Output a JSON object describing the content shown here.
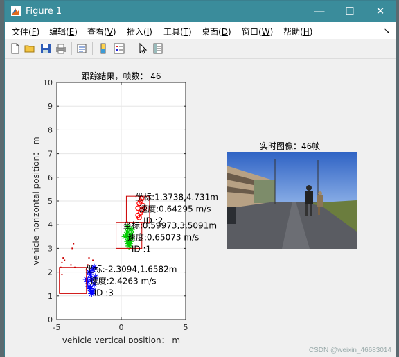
{
  "window": {
    "title": "Figure 1",
    "min": "—",
    "max": "☐",
    "close": "✕"
  },
  "menu": [
    {
      "label": "文件(",
      "key": "F",
      "end": ")"
    },
    {
      "label": "编辑(",
      "key": "E",
      "end": ")"
    },
    {
      "label": "查看(",
      "key": "V",
      "end": ")"
    },
    {
      "label": "插入(",
      "key": "I",
      "end": ")"
    },
    {
      "label": "工具(",
      "key": "T",
      "end": ")"
    },
    {
      "label": "桌面(",
      "key": "D",
      "end": ")"
    },
    {
      "label": "窗口(",
      "key": "W",
      "end": ")"
    },
    {
      "label": "帮助(",
      "key": "H",
      "end": ")"
    }
  ],
  "toolbar": [
    "new-figure-icon",
    "open-file-icon",
    "save-icon",
    "print-icon",
    "link-icon",
    "colorbar-icon",
    "legend-icon",
    "pointer-icon",
    "property-editor-icon"
  ],
  "chart_data": {
    "type": "scatter",
    "title": "跟踪结果，帧数：  46",
    "xlabel": "vehicle vertical position：  m",
    "ylabel": "vehicle horizontal position：  m",
    "xlim": [
      -5,
      5
    ],
    "ylim": [
      0,
      10
    ],
    "xticks": [
      -5,
      0,
      5
    ],
    "yticks": [
      0,
      1,
      2,
      3,
      4,
      5,
      6,
      7,
      8,
      9,
      10
    ],
    "grid": true,
    "objects": [
      {
        "id": "ID :2",
        "color": "#ff0000",
        "marker": "o",
        "box": [
          0.4,
          4.1,
          2.2,
          5.2
        ],
        "coord": "坐标:1.3738,4.731m",
        "speed": "速度:0.64295  m/s",
        "points": [
          [
            1.3,
            4.7
          ],
          [
            1.5,
            5.0
          ],
          [
            1.6,
            4.6
          ],
          [
            1.4,
            4.9
          ],
          [
            1.7,
            4.8
          ],
          [
            1.5,
            4.5
          ],
          [
            1.6,
            5.1
          ],
          [
            1.3,
            4.4
          ],
          [
            1.8,
            4.7
          ],
          [
            1.4,
            4.3
          ]
        ]
      },
      {
        "id": "ID :1",
        "color": "#00cc00",
        "marker": "*",
        "box": [
          -0.4,
          3.0,
          1.6,
          4.1
        ],
        "coord": "坐标:0.59973,3.5091m",
        "speed": "速度:0.65073  m/s",
        "points": [
          [
            0.6,
            3.5
          ],
          [
            0.5,
            3.7
          ],
          [
            0.7,
            3.3
          ],
          [
            0.4,
            3.6
          ],
          [
            0.8,
            3.8
          ],
          [
            0.6,
            3.2
          ],
          [
            0.5,
            3.9
          ],
          [
            0.7,
            3.4
          ],
          [
            0.3,
            3.5
          ],
          [
            0.8,
            3.6
          ],
          [
            0.6,
            3.1
          ],
          [
            0.5,
            3.3
          ]
        ]
      },
      {
        "id": "ID :3",
        "color": "#0000ff",
        "marker": "*",
        "box": [
          -4.8,
          1.1,
          -2.7,
          2.2
        ],
        "coord": "坐标:-2.3094,1.6582m",
        "speed": "速度:2.4263  m/s",
        "points": [
          [
            -2.3,
            1.7
          ],
          [
            -2.5,
            2.0
          ],
          [
            -2.1,
            1.5
          ],
          [
            -2.4,
            1.3
          ],
          [
            -2.2,
            2.1
          ],
          [
            -2.6,
            1.6
          ],
          [
            -2.0,
            1.8
          ],
          [
            -2.3,
            1.1
          ],
          [
            -2.5,
            1.4
          ],
          [
            -2.1,
            2.2
          ],
          [
            -2.4,
            1.9
          ],
          [
            -2.2,
            1.2
          ],
          [
            -2.7,
            1.7
          ]
        ]
      }
    ],
    "noise": {
      "color": "#cc0000",
      "points": [
        [
          -4.6,
          2.4
        ],
        [
          -4.5,
          2.6
        ],
        [
          -4.7,
          2.2
        ],
        [
          -3.8,
          3.0
        ],
        [
          -3.7,
          3.2
        ],
        [
          -3.9,
          2.3
        ],
        [
          -4.4,
          2.5
        ],
        [
          -2.7,
          2.1
        ],
        [
          -2.6,
          2.3
        ],
        [
          -2.5,
          2.6
        ],
        [
          -2.2,
          2.5
        ],
        [
          -4.6,
          1.9
        ],
        [
          -3.6,
          2.2
        ]
      ]
    }
  },
  "image_panel": {
    "title": "实时图像：46帧"
  },
  "watermark": "CSDN @weixin_46683014"
}
